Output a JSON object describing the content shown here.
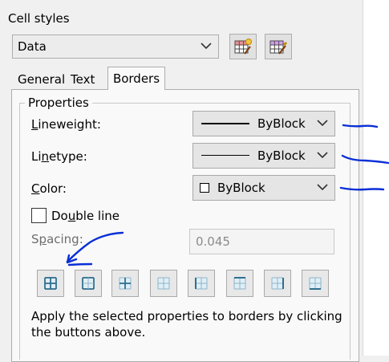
{
  "dialog": {
    "title": "Cell styles",
    "style_select": {
      "value": "Data"
    }
  },
  "tabs": [
    {
      "label": "General"
    },
    {
      "label": "Text"
    },
    {
      "label": "Borders",
      "active": true
    }
  ],
  "properties": {
    "group_label": "Properties",
    "lineweight": {
      "label_pre": "",
      "label_u": "L",
      "label_post": "ineweight:",
      "value": "ByBlock"
    },
    "linetype": {
      "label_pre": "Li",
      "label_u": "n",
      "label_post": "etype:",
      "value": "ByBlock"
    },
    "color": {
      "label_pre": "",
      "label_u": "C",
      "label_post": "olor:",
      "value": "ByBlock"
    },
    "double_line": {
      "label_pre": "Do",
      "label_u": "u",
      "label_post": "ble line",
      "checked": false
    },
    "spacing": {
      "label_pre": "S",
      "label_u": "p",
      "label_post": "acing:",
      "value": "0.045",
      "enabled": false
    }
  },
  "border_buttons": [
    "all-borders-icon",
    "outside-borders-icon",
    "inside-borders-icon",
    "no-border-icon",
    "left-border-icon",
    "top-border-icon",
    "right-border-icon",
    "bottom-border-icon"
  ],
  "help_text": "Apply the selected properties to borders by clicking the buttons above.",
  "colors": {
    "ink_annotation": "#0a2fd6",
    "grid_icon": "#2f6f8f"
  }
}
